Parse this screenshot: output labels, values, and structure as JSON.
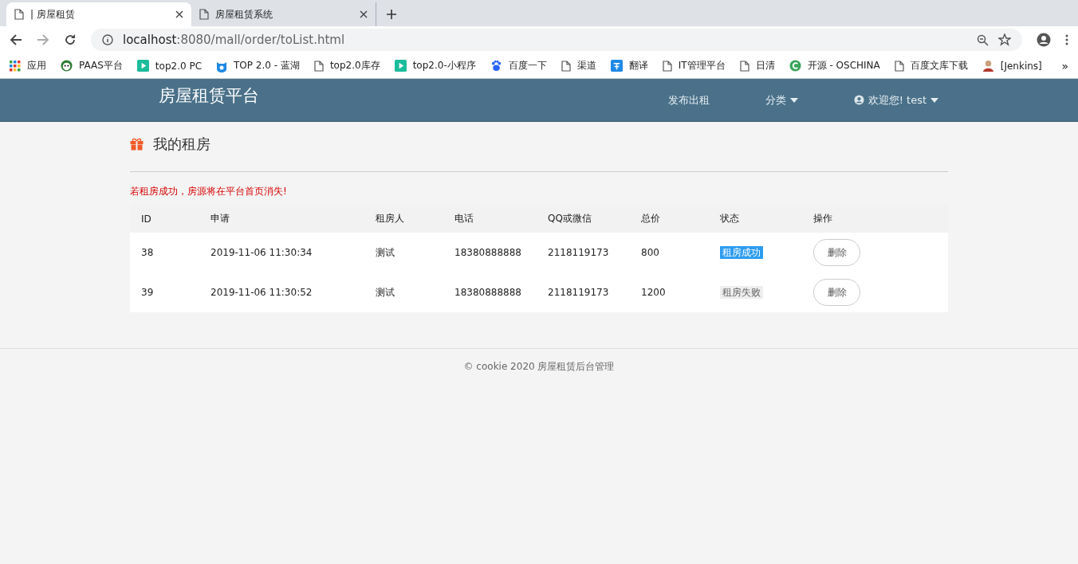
{
  "browser": {
    "tabs": [
      {
        "title": "| 房屋租赁",
        "selected": true
      },
      {
        "title": "房屋租赁系统",
        "selected": false
      }
    ],
    "url_host": "localhost",
    "url_rest": ":8080/mall/order/toList.html",
    "bookmarks": [
      {
        "label": "应用",
        "kind": "apps"
      },
      {
        "label": "PAAS平台",
        "kind": "panda"
      },
      {
        "label": "top2.0 PC",
        "kind": "play"
      },
      {
        "label": "TOP 2.0 - 蓝湖",
        "kind": "bird"
      },
      {
        "label": "top2.0库存",
        "kind": "page"
      },
      {
        "label": "top2.0-小程序",
        "kind": "play"
      },
      {
        "label": "百度一下",
        "kind": "paw"
      },
      {
        "label": "渠道",
        "kind": "page"
      },
      {
        "label": "翻译",
        "kind": "translate"
      },
      {
        "label": "IT管理平台",
        "kind": "page"
      },
      {
        "label": "日清",
        "kind": "page"
      },
      {
        "label": "开源 - OSCHINA",
        "kind": "c"
      },
      {
        "label": "百度文库下载",
        "kind": "page"
      },
      {
        "label": "[Jenkins]",
        "kind": "avatar"
      }
    ],
    "bookmarks_more": "»"
  },
  "navbar": {
    "brand": "房屋租赁平台",
    "links": [
      {
        "label": "发布出租",
        "kind": "plain"
      },
      {
        "label": "分类",
        "kind": "dropdown"
      },
      {
        "label": "欢迎您! test",
        "kind": "user"
      }
    ]
  },
  "page": {
    "title": "我的租房",
    "notice": "若租房成功，房源将在平台首页消失!"
  },
  "table": {
    "columns": [
      "ID",
      "申请",
      "租房人",
      "电话",
      "QQ或微信",
      "总价",
      "状态",
      "操作"
    ],
    "rows": [
      {
        "id": "38",
        "applied": "2019-11-06 11:30:34",
        "tenant": "测试",
        "phone": "18380888888",
        "contact": "2118119173",
        "total": "800",
        "status": {
          "text": "租房成功",
          "kind": "success"
        },
        "action": "删除"
      },
      {
        "id": "39",
        "applied": "2019-11-06 11:30:52",
        "tenant": "测试",
        "phone": "18380888888",
        "contact": "2118119173",
        "total": "1200",
        "status": {
          "text": "租房失败",
          "kind": "failed"
        },
        "action": "删除"
      }
    ]
  },
  "footer": "© cookie 2020 房屋租赁后台管理"
}
